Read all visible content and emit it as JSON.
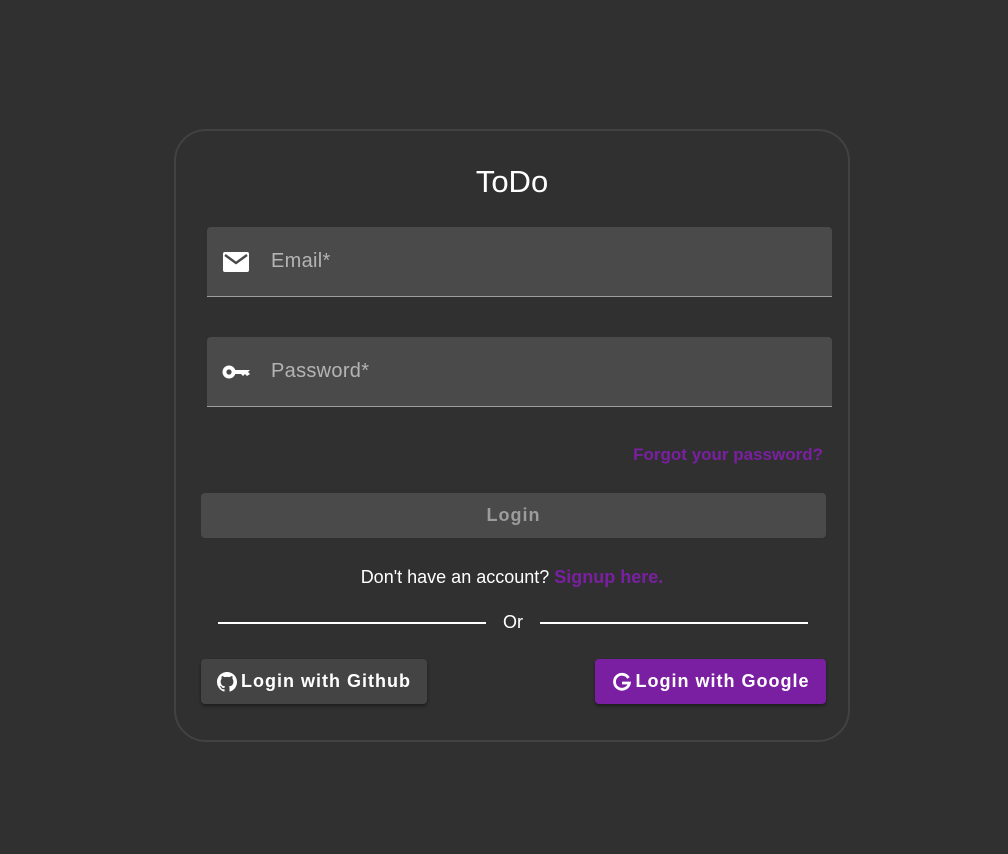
{
  "app": {
    "title": "ToDo"
  },
  "form": {
    "email": {
      "placeholder": "Email*",
      "value": "",
      "icon": "mail-icon"
    },
    "password": {
      "placeholder": "Password*",
      "value": "",
      "icon": "key-icon"
    },
    "forgot_label": "Forgot your password?",
    "login_label": "Login"
  },
  "signup": {
    "prompt": "Don't have an account?",
    "link_label": "Signup here."
  },
  "divider": {
    "label": "Or"
  },
  "social": {
    "github": {
      "label": "Login with Github",
      "icon": "github-icon"
    },
    "google": {
      "label": "Login with Google",
      "icon": "google-g-icon"
    }
  },
  "colors": {
    "background": "#303030",
    "card_border": "#424242",
    "field_background": "#4a4a4a",
    "accent": "#7b1fa2",
    "disabled_text": "#9c9c9c",
    "github_button": "#444444"
  }
}
